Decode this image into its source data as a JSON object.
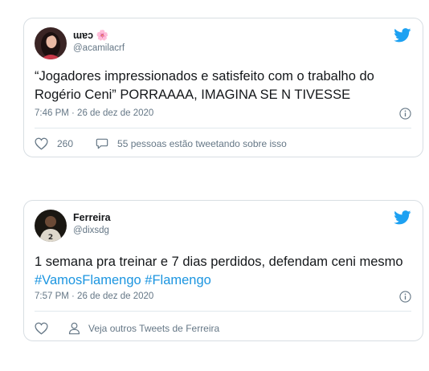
{
  "tweets": [
    {
      "author_name": "ɯɐɔ 🌸",
      "handle": "@acamilacrf",
      "text": "“Jogadores impressionados e satisfeito com o trabalho do Rogério Ceni” PORRAAAA, IMAGINA SE N TIVESSE",
      "timestamp": "7:46 PM · 26 de dez de 2020",
      "like_count": "260",
      "reply_text": "55 pessoas estão tweetando sobre isso",
      "avatar_icon": "avatar-photo-woman",
      "brand_color": "#1da1f2"
    },
    {
      "author_name": "Ferreira",
      "handle": "@dixsdg",
      "text_prefix": "1 semana pra treinar e 7 dias perdidos, defendam ceni mesmo",
      "hashtags": [
        "#VamosFlamengo",
        "#Flamengo"
      ],
      "timestamp": "7:57 PM · 26 de dez de 2020",
      "profile_link_text": "Veja outros Tweets de Ferreira",
      "avatar_icon": "avatar-photo-player",
      "brand_color": "#1da1f2"
    }
  ]
}
